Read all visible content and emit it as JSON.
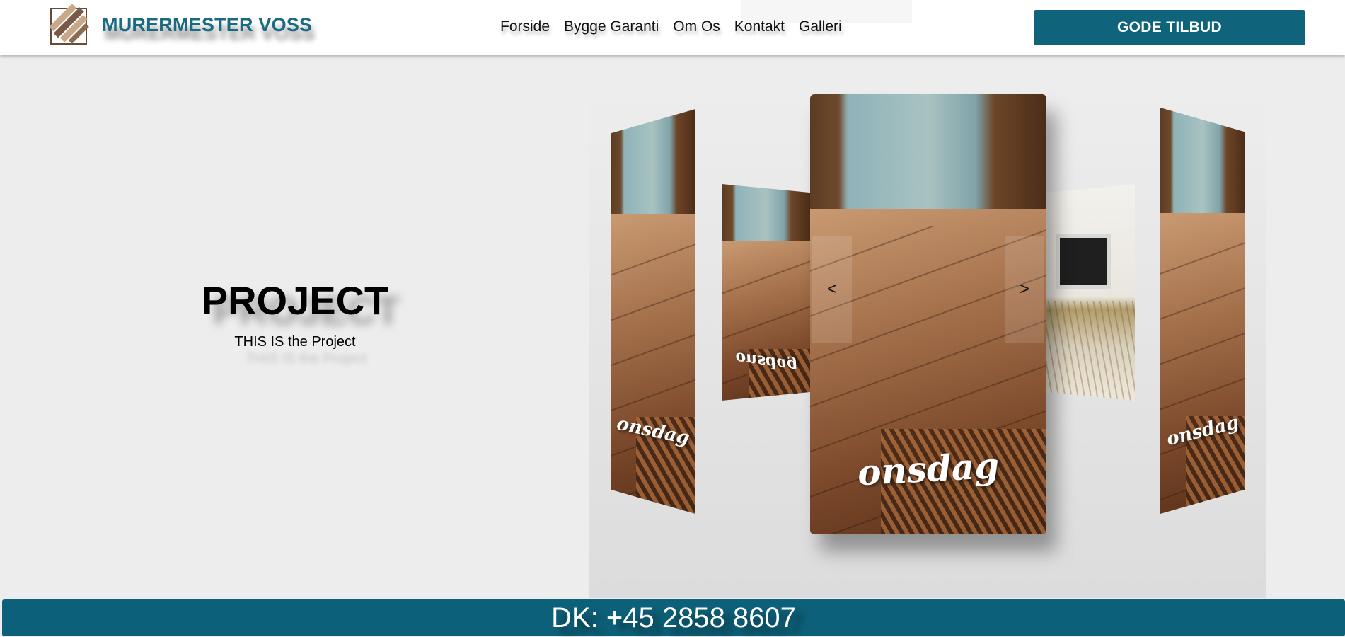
{
  "brand": {
    "name": "MURERMESTER VOSS",
    "logo_icon": "brick-diamond-logo-icon"
  },
  "nav": {
    "items": [
      "Forside",
      "Bygge Garanti",
      "Om Os",
      "Kontakt",
      "Galleri"
    ]
  },
  "cta": {
    "label": "GODE TILBUD"
  },
  "hero": {
    "title": "PROJECT",
    "subtitle": "THIS IS the Project"
  },
  "carousel": {
    "prev_label": "<",
    "next_label": ">",
    "captions": {
      "left": "onsdag",
      "left2": "onsdag",
      "center": "onsdag",
      "right": "onsdag"
    }
  },
  "footer": {
    "phone": "DK: +45 2858 8607"
  },
  "colors": {
    "accent": "#0f647c",
    "brand_text": "#1a6a82",
    "background": "#ededed"
  }
}
